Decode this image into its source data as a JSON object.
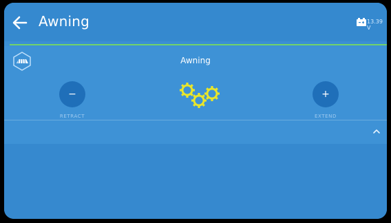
{
  "header": {
    "title": "Awning",
    "voltage": "13.39 V",
    "back_icon": "arrow-left-icon",
    "battery_icon": "battery-icon"
  },
  "panel": {
    "title": "Awning",
    "awning_icon": "awning-icon",
    "status_icon": "gears-icon",
    "retract": {
      "symbol": "−",
      "label": "RETRACT"
    },
    "extend": {
      "symbol": "+",
      "label": "EXTEND"
    },
    "collapse_icon": "chevron-up-icon"
  },
  "colors": {
    "background": "#3b8fd4",
    "accent_line": "#72d36a",
    "button": "#1f6fb9",
    "gears": "#e9e62a"
  }
}
